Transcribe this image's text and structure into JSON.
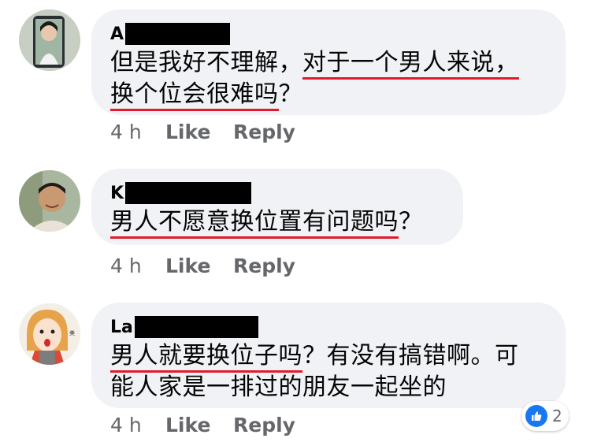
{
  "comments": [
    {
      "author": "A",
      "lines": [
        [
          "但是我好不理解，",
          "对于一个男人来说，"
        ],
        [
          "换个位会很难吗",
          "？"
        ]
      ],
      "time": "4 h",
      "like": "Like",
      "reply": "Reply"
    },
    {
      "author": "K",
      "lines": [
        [
          "男人不愿意换位置有问题吗",
          "？"
        ]
      ],
      "time": "4 h",
      "like": "Like",
      "reply": "Reply"
    },
    {
      "author": "La",
      "lines": [
        [
          "男人就要换位子吗",
          "？有没有搞错啊。可"
        ],
        [
          "能人家是一排过的朋友一起坐的"
        ]
      ],
      "time": "4 h",
      "like": "Like",
      "reply": "Reply",
      "reaction_count": "2"
    }
  ],
  "colors": {
    "bubble": "#f0f2f5",
    "underline": "#e01b2a",
    "like_blue": "#1877f2",
    "meta": "#65676b"
  }
}
